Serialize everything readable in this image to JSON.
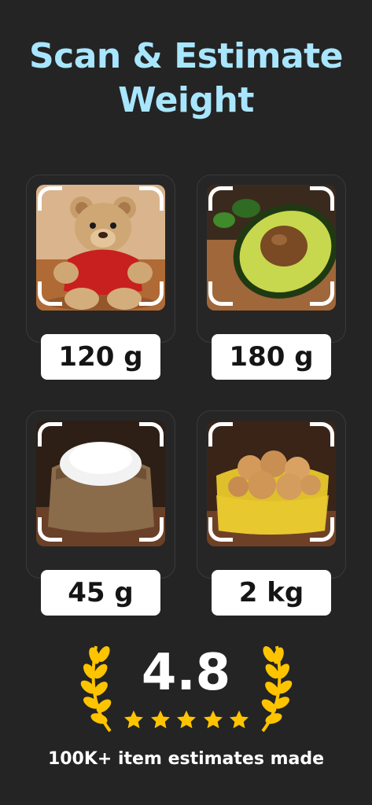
{
  "header": {
    "title": "Scan & Estimate Weight"
  },
  "items": [
    {
      "name": "teddy-bear",
      "weight": "120 g"
    },
    {
      "name": "avocado",
      "weight": "180 g"
    },
    {
      "name": "salt-sack",
      "weight": "45 g"
    },
    {
      "name": "potatoes",
      "weight": "2 kg"
    }
  ],
  "rating": {
    "value": "4.8",
    "stars": 5,
    "caption": "100K+ item estimates made"
  },
  "colors": {
    "background": "#242424",
    "title": "#a8e6ff",
    "gold": "#ffc400",
    "label_bg": "#ffffff"
  }
}
